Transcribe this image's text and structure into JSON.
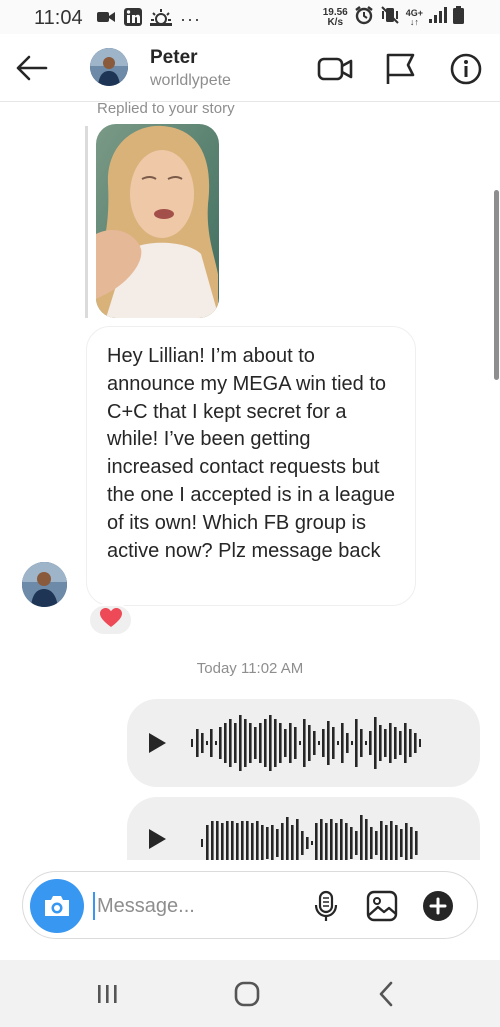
{
  "status_bar": {
    "time": "11:04",
    "speed_value": "19.56",
    "speed_unit": "K/s",
    "network": "4G+"
  },
  "header": {
    "name": "Peter",
    "handle": "worldlypete",
    "icons": [
      "back-arrow-icon",
      "video-camera-icon",
      "flag-icon",
      "info-icon"
    ]
  },
  "chat": {
    "replied_label": "Replied to your story",
    "message_text": "Hey Lillian! I’m about to announce my MEGA win tied to C+C that I kept secret for a while! I’ve been getting increased contact requests but the one I accepted is in a league of its own! Which FB group is active now? Plz message back",
    "reaction": "❤️",
    "timestamp": "Today 11:02 AM"
  },
  "composer": {
    "placeholder": "Message...",
    "icons": [
      "camera-icon",
      "microphone-icon",
      "gallery-icon",
      "plus-icon"
    ]
  },
  "colors": {
    "accent": "#3897f0",
    "bubble_gray": "#efefef",
    "text_primary": "#262626",
    "text_secondary": "#8e8e8e",
    "heart": "#ed4956"
  }
}
